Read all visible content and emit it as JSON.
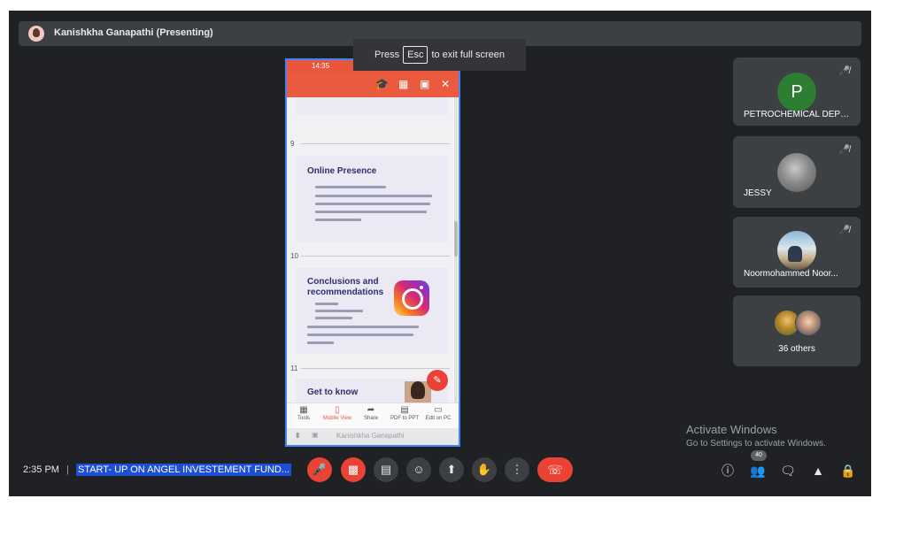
{
  "presenter": {
    "name": "Kanishkha Ganapathi (Presenting)"
  },
  "fullscreen_tip": {
    "prefix": "Press",
    "key": "Esc",
    "suffix": "to exit full screen"
  },
  "phone": {
    "status_time": "14:35",
    "document": {
      "pages": [
        {
          "number": "9",
          "title": "Online Presence"
        },
        {
          "number": "10",
          "title": "Conclusions and recommendations"
        },
        {
          "number": "11",
          "title": "Get to know"
        }
      ]
    },
    "tabs": [
      {
        "label": "Tools",
        "icon": "grid-icon"
      },
      {
        "label": "Mobile View",
        "icon": "mobile-icon",
        "active": true
      },
      {
        "label": "Share",
        "icon": "share-icon"
      },
      {
        "label": "PDF to PPT",
        "icon": "ppt-icon"
      },
      {
        "label": "Edit on PC",
        "icon": "pc-icon"
      }
    ],
    "bottom_name": "Kanishkha Ganapathi"
  },
  "participants": [
    {
      "name": "PETROCHEMICAL DEPT...",
      "avatar_letter": "P",
      "avatar_color": "#2e7d32"
    },
    {
      "name": "JESSY"
    },
    {
      "name": "Noormohammed Noor..."
    }
  ],
  "others": {
    "label": "36 others"
  },
  "windows_watermark": {
    "title": "Activate Windows",
    "subtitle": "Go to Settings to activate Windows."
  },
  "bottom_bar": {
    "time": "2:35 PM",
    "meeting_title": "START- UP ON ANGEL INVESTEMENT FUND...",
    "participant_count": "40"
  },
  "colors": {
    "meet_bg": "#202124",
    "tile_bg": "#3c4043",
    "danger": "#ea4335",
    "presenting_border": "#4285f4",
    "doc_accent": "#ea5a3e"
  }
}
